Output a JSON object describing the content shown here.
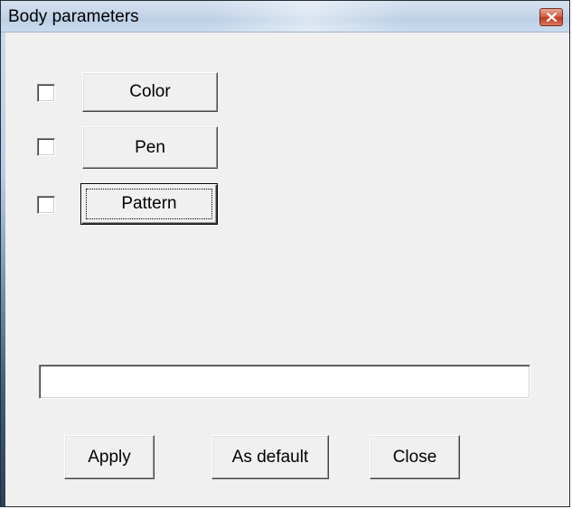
{
  "window": {
    "title": "Body parameters"
  },
  "rows": [
    {
      "checked": false,
      "label": "Color"
    },
    {
      "checked": false,
      "label": "Pen"
    },
    {
      "checked": false,
      "label": "Pattern",
      "focused": true
    }
  ],
  "text_field": {
    "value": "",
    "placeholder": ""
  },
  "footer": {
    "apply_label": "Apply",
    "as_default_label": "As default",
    "close_label": "Close"
  },
  "colors": {
    "dialog_background": "#f0f0f0",
    "title_bar": "#c7d7ea",
    "close_button": "#c0381f"
  },
  "icons": {
    "close": "close-icon"
  }
}
